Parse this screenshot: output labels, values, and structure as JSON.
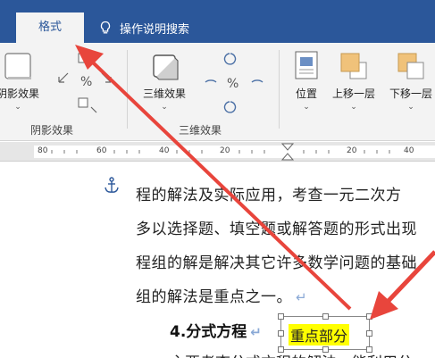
{
  "tabs": {
    "active_tab": "格式",
    "search_label": "操作说明搜索"
  },
  "ribbon": {
    "shadow_group": {
      "button_label": "阴影效果",
      "group_label": "阴影效果"
    },
    "threed_group": {
      "button_label": "三维效果",
      "group_label": "三维效果"
    },
    "arrange_group": {
      "position_label": "位置",
      "bring_forward_label": "上移一层",
      "send_backward_label": "下移一层"
    }
  },
  "ruler": {
    "numbers": [
      "80",
      "60",
      "40",
      "20",
      "20",
      "40"
    ]
  },
  "document": {
    "line1": "程的解法及实际应用，考查一元二次方",
    "line2": "多以选择题、填空题或解答题的形式出现",
    "line3": "程组的解是解决其它许多数学问题的基础",
    "line4": "组的解法是重点之一。",
    "paragraph_mark": "↵",
    "heading": "4.分式方程",
    "textbox_text": "重点部分",
    "partial_line": "主要考查分式方程的解法，能利用分"
  },
  "colors": {
    "brand": "#2b579a",
    "arrow": "#e8453c",
    "highlight": "#ffff00"
  }
}
